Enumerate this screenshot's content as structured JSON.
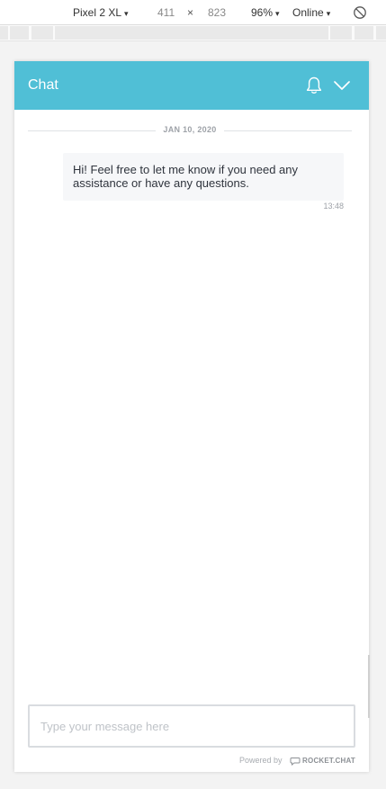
{
  "devtools": {
    "device": "Pixel 2 XL",
    "width": "411",
    "times": "×",
    "height": "823",
    "zoom": "96%",
    "network": "Online",
    "caret": "▾"
  },
  "chat": {
    "title": "Chat",
    "date_separator": "JAN 10, 2020",
    "message": {
      "text": "Hi! Feel free to let me know if you need any assistance or have any questions.",
      "time": "13:48"
    },
    "composer": {
      "placeholder": "Type your message here"
    },
    "footer": {
      "powered_by": "Powered by",
      "brand": "ROCKET.CHAT"
    }
  },
  "colors": {
    "header": "#50bfd6",
    "bubble": "#f6f7f9"
  }
}
